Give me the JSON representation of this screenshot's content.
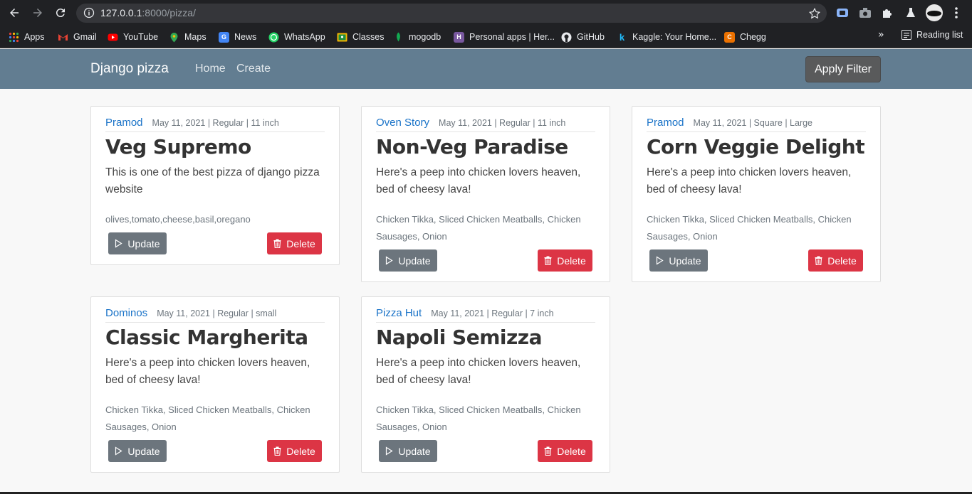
{
  "browser": {
    "url_host": "127.0.0.1",
    "url_rest": ":8000/pizza/",
    "bookmarks": [
      "Apps",
      "Gmail",
      "YouTube",
      "Maps",
      "News",
      "WhatsApp",
      "Classes",
      "mogodb",
      "Personal apps | Her...",
      "GitHub",
      "Kaggle: Your Home...",
      "Chegg"
    ],
    "bookmarks_more": "»",
    "reading_list": "Reading list"
  },
  "site": {
    "brand": "Django pizza",
    "nav": [
      "Home",
      "Create"
    ],
    "filter_button": "Apply Filter",
    "colors": {
      "navbar": "#627d91",
      "author": "#1a73c8",
      "update": "#6c757d",
      "delete": "#dc3545"
    }
  },
  "cards": [
    {
      "author": "Pramod",
      "meta": "May 11, 2021 | Regular | 11 inch",
      "title": "Veg Supremo",
      "description": "This is one of the best pizza of django pizza website",
      "toppings": "olives,tomato,cheese,basil,oregano",
      "update_label": "Update",
      "delete_label": "Delete"
    },
    {
      "author": "Oven Story",
      "meta": "May 11, 2021 | Regular | 11 inch",
      "title": "Non-Veg Paradise",
      "description": "Here's a peep into chicken lovers heaven, bed of cheesy lava!",
      "toppings": "Chicken Tikka, Sliced Chicken Meatballs, Chicken Sausages, Onion",
      "update_label": "Update",
      "delete_label": "Delete"
    },
    {
      "author": "Pramod",
      "meta": "May 11, 2021 | Square | Large",
      "title": "Corn Veggie Delight",
      "description": "Here's a peep into chicken lovers heaven, bed of cheesy lava!",
      "toppings": "Chicken Tikka, Sliced Chicken Meatballs, Chicken Sausages, Onion",
      "update_label": "Update",
      "delete_label": "Delete"
    },
    {
      "author": "Dominos",
      "meta": "May 11, 2021 | Regular | small",
      "title": "Classic Margherita",
      "description": "Here's a peep into chicken lovers heaven, bed of cheesy lava!",
      "toppings": "Chicken Tikka, Sliced Chicken Meatballs, Chicken Sausages, Onion",
      "update_label": "Update",
      "delete_label": "Delete"
    },
    {
      "author": "Pizza Hut",
      "meta": "May 11, 2021 | Regular | 7 inch",
      "title": "Napoli Semizza",
      "description": "Here's a peep into chicken lovers heaven, bed of cheesy lava!",
      "toppings": "Chicken Tikka, Sliced Chicken Meatballs, Chicken Sausages, Onion",
      "update_label": "Update",
      "delete_label": "Delete"
    }
  ]
}
